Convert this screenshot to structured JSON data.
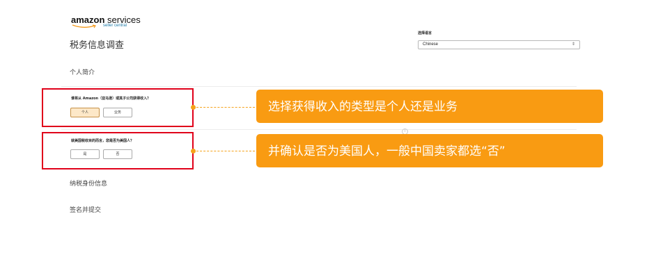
{
  "logo": {
    "brand": "amazon",
    "services": "services",
    "sub": "seller central"
  },
  "page_title": "税务信息调查",
  "language": {
    "label": "选择语言",
    "selected": "Chinese"
  },
  "sections": {
    "profile": "个人简介",
    "tax_identity": "纳税身份信息",
    "sign_submit": "签名并提交"
  },
  "question1": {
    "text": "谁将从 Amazon（亚马逊）或其子公司获得收入？",
    "options": [
      "个人",
      "业务"
    ],
    "selected": "个人"
  },
  "question2": {
    "text": "就美国税收目的而言，您是否为美国人？",
    "options": [
      "是",
      "否"
    ]
  },
  "callouts": [
    "选择获得收入的类型是个人还是业务",
    "并确认是否为美国人，一般中国卖家都选“否”"
  ],
  "colors": {
    "accent": "#f99b12",
    "highlight_border": "#e0001a"
  },
  "icons": {
    "info": "info-icon",
    "select_arrow": "chevron-updown-icon"
  }
}
